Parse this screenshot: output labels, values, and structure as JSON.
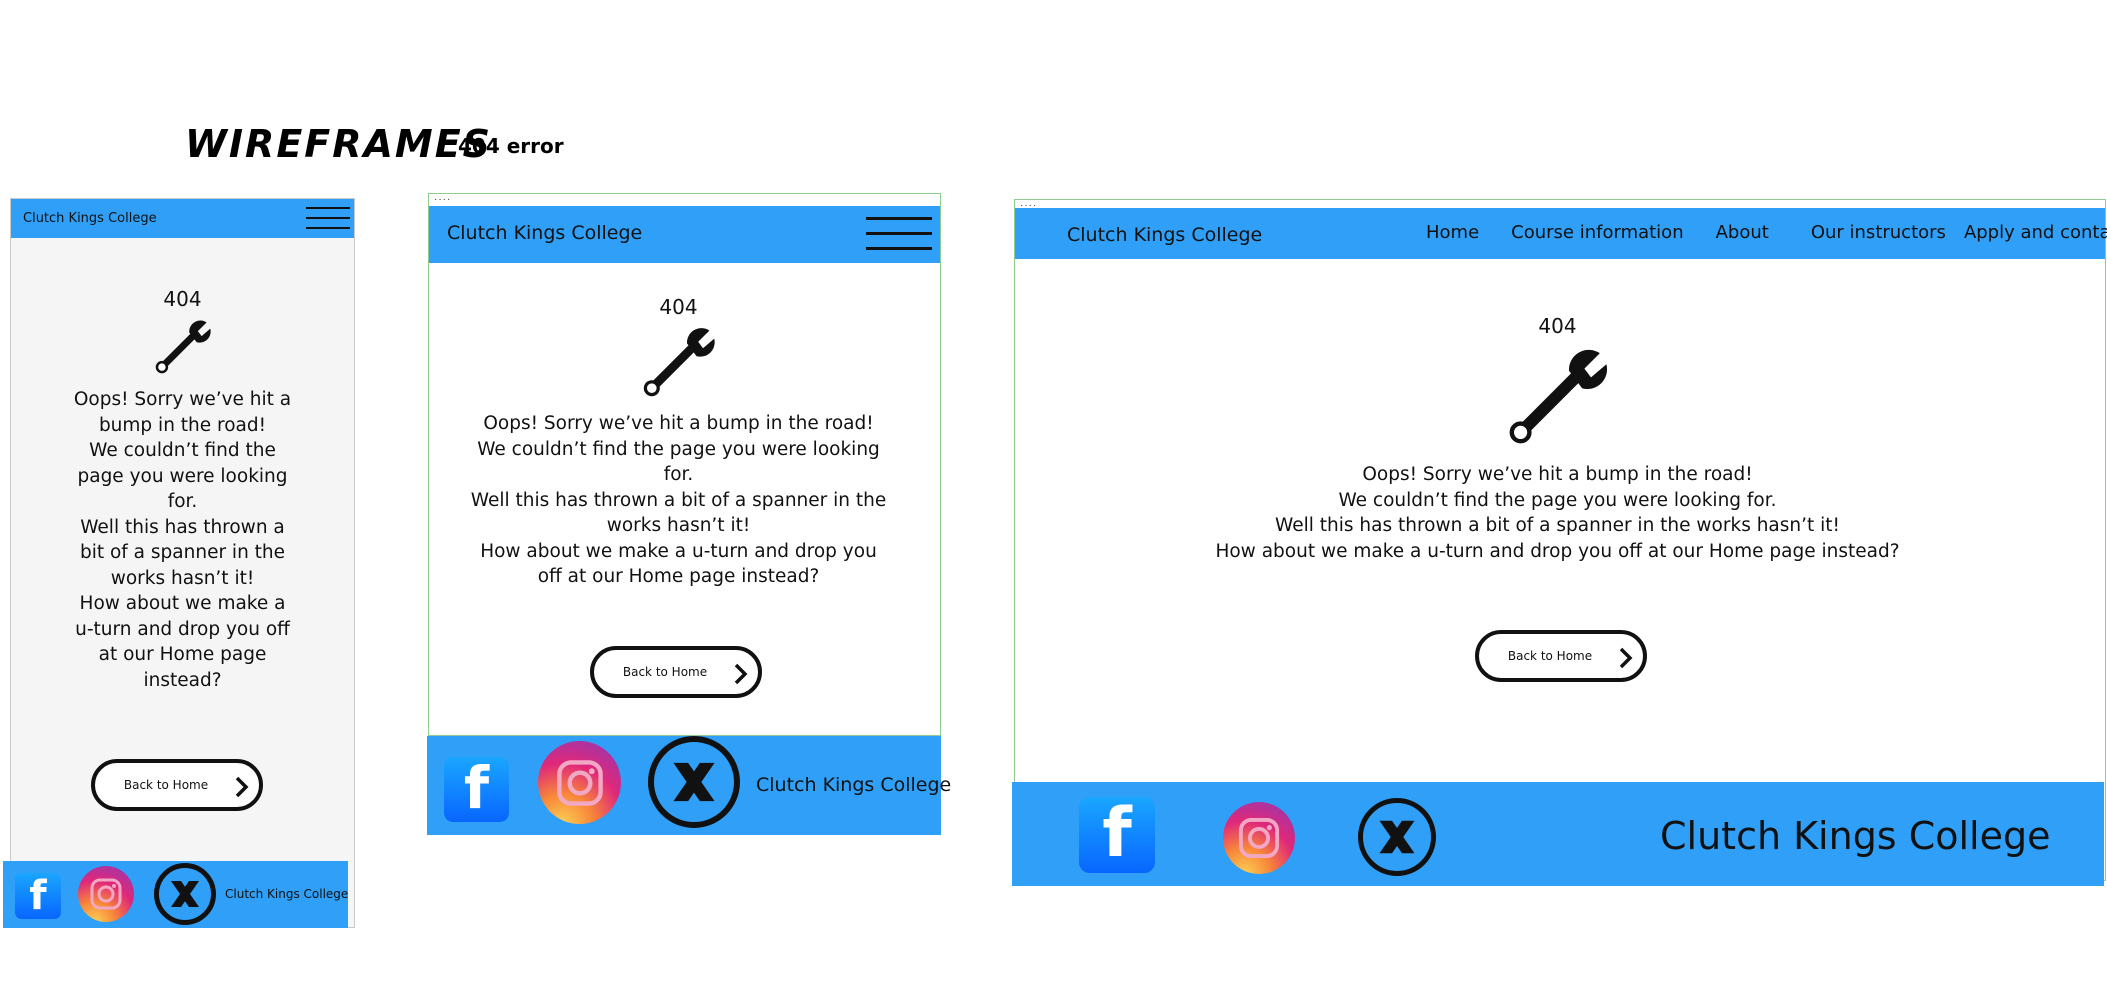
{
  "page": {
    "title": "WIREFRAMES",
    "subtitle": "404 error"
  },
  "common": {
    "brand": "Clutch Kings College",
    "error_code": "404",
    "button_label": "Back to Home",
    "footer_brand": "Clutch Kings College",
    "colors": {
      "header_blue": "#2f9ff8",
      "frame_border": "#8fcc8f",
      "text": "#111111"
    },
    "icons": [
      "wrench-icon",
      "facebook-icon",
      "instagram-icon",
      "x-icon",
      "hamburger-icon",
      "chevron-right-icon"
    ]
  },
  "mobile": {
    "message": [
      "Oops! Sorry we’ve hit a",
      "bump in the road!",
      "We couldn’t find the",
      "page you were looking",
      "for.",
      "Well this has thrown a",
      "bit of a spanner in the",
      "works hasn’t it!",
      "How about we make a",
      "u-turn and drop you off",
      "at our Home page",
      "instead?"
    ]
  },
  "tablet": {
    "message": [
      "Oops! Sorry we’ve hit a bump in the road!",
      "We couldn’t find the page you were looking",
      "for.",
      "Well this has thrown a bit of a spanner in the",
      "works hasn’t it!",
      "How about we make a u-turn and drop you",
      "off at our Home page instead?"
    ]
  },
  "desktop": {
    "nav": [
      "Home",
      "Course information",
      "About",
      "Our instructors",
      "Apply and contact"
    ],
    "message": [
      "Oops! Sorry we’ve hit a bump in the road!",
      "We couldn’t find the page you were looking for.",
      "Well this has thrown a bit of a spanner in the works hasn’t it!",
      "How about we make a u-turn and drop you off at our Home page instead?"
    ]
  }
}
